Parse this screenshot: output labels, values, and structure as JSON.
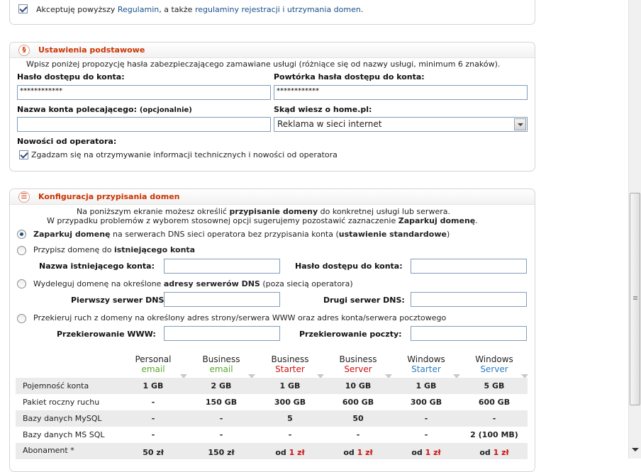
{
  "terms": {
    "prefix": "Akceptuję powyższy ",
    "link1": "Regulamin",
    "middle": ", a także ",
    "link2": "regulaminy rejestracji i utrzymania domen",
    "suffix": "."
  },
  "basic": {
    "title": "Ustawienia podstawowe",
    "icon": "§",
    "intro": "Wpisz poniżej propozycję hasła zabezpieczającego zamawiane usługi (różniące się od nazwy usługi, minimum 6 znaków).",
    "password_label": "Hasło dostępu do konta:",
    "password_value": "************",
    "password_repeat_label": "Powtórka hasła dostępu do konta:",
    "password_repeat_value": "************",
    "referrer_label": "Nazwa konta polecającego:",
    "referrer_optional": "(opcjonalnie)",
    "referrer_value": "",
    "source_label": "Skąd wiesz o home.pl:",
    "source_selected": "Reklama w sieci internet",
    "news_label": "Nowości od operatora:",
    "news_checkbox_text": "Zgadzam się na otrzymywanie informacji technicznych i nowości od operatora"
  },
  "domains": {
    "title": "Konfiguracja przypisania domen",
    "icon": "☰",
    "intro1_a": "Na poniższym ekranie możesz określić ",
    "intro1_b": "przypisanie domeny",
    "intro1_c": " do konkretnej usługi lub serwera.",
    "intro2_a": "W przypadku problemów z wyborem stosownej opcji sugerujemy pozostawić zaznaczenie ",
    "intro2_b": "Zaparkuj domenę",
    "intro2_c": ".",
    "opt1_a": "Zaparkuj domenę",
    "opt1_b": " na serwerach DNS sieci operatora bez przypisania konta (",
    "opt1_c": "ustawienie standardowe",
    "opt1_d": ")",
    "opt2_a": "Przypisz domenę do ",
    "opt2_b": "istniejącego konta",
    "existing_account_label": "Nazwa istniejącego konta:",
    "existing_password_label": "Hasło dostępu do konta:",
    "opt3_a": "Wydeleguj domenę na określone ",
    "opt3_b": "adresy serwerów DNS",
    "opt3_c": " (poza siecią operatora)",
    "dns1_label": "Pierwszy serwer DNS:",
    "dns2_label": "Drugi serwer DNS:",
    "opt4": "Przekieruj ruch z domeny na określony adres strony/serwera WWW oraz adres konta/serwera pocztowego",
    "www_redirect_label": "Przekierowanie WWW:",
    "mail_redirect_label": "Przekierowanie poczty:"
  },
  "packages": [
    {
      "name": "Personal",
      "sub": "email",
      "sub_color": "#5aa62e"
    },
    {
      "name": "Business",
      "sub": "email",
      "sub_color": "#5aa62e"
    },
    {
      "name": "Business",
      "sub": "Starter",
      "sub_color": "#cc1111"
    },
    {
      "name": "Business",
      "sub": "Server",
      "sub_color": "#cc1111"
    },
    {
      "name": "Windows",
      "sub": "Starter",
      "sub_color": "#2a7fc4"
    },
    {
      "name": "Windows",
      "sub": "Server",
      "sub_color": "#2a7fc4"
    }
  ],
  "table_rows": [
    {
      "label": "Pojemność konta",
      "cells": [
        "1 GB",
        "2 GB",
        "1 GB",
        "10 GB",
        "1 GB",
        "5 GB"
      ]
    },
    {
      "label": "Pakiet roczny ruchu",
      "cells": [
        "-",
        "150 GB",
        "300 GB",
        "600 GB",
        "300 GB",
        "600 GB"
      ]
    },
    {
      "label": "Bazy danych MySQL",
      "cells": [
        "-",
        "-",
        "5",
        "50",
        "-",
        "-"
      ]
    },
    {
      "label": "Bazy danych MS SQL",
      "cells": [
        "-",
        "-",
        "-",
        "-",
        "-",
        "2 (100 MB)"
      ]
    }
  ],
  "subscription": {
    "label": "Abonament *",
    "cells": [
      {
        "prefix": "",
        "price": "50 zł",
        "red": false
      },
      {
        "prefix": "",
        "price": "150 zł",
        "red": false
      },
      {
        "prefix": "od ",
        "price": "1 zł",
        "red": true
      },
      {
        "prefix": "od ",
        "price": "1 zł",
        "red": true
      },
      {
        "prefix": "od ",
        "price": "1 zł",
        "red": true
      },
      {
        "prefix": "od ",
        "price": "1 zł",
        "red": true
      }
    ]
  }
}
